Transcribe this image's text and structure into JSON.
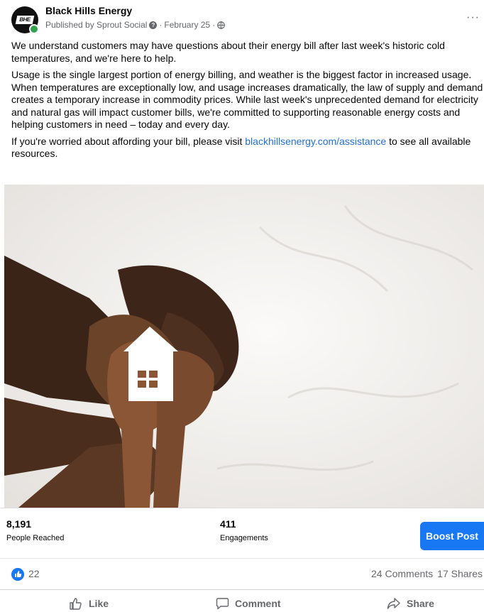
{
  "post": {
    "page_name": "Black Hills Energy",
    "published_by": "Published by Sprout Social",
    "date": "February 25",
    "separator": "·",
    "avatar_text": "BHE",
    "more": "···"
  },
  "body": {
    "p1": "We understand customers may have questions about their energy bill after last week's historic cold temperatures, and we're here to help.",
    "p2": "Usage is the single largest portion of energy billing, and weather is the biggest factor in increased usage. When temperatures are exceptionally low, and usage increases dramatically, the law of supply and demand creates a temporary increase in commodity prices. While last week's unprecedented demand for electricity and natural gas will impact customer bills, we're committed to supporting reasonable energy costs and helping customers in need – today and every day.",
    "p3_before": "If you're worried about affording your bill, please visit ",
    "p3_link": "blackhillsenergy.com/assistance",
    "p3_after": " to see all available resources."
  },
  "stats": {
    "reached_value": "8,191",
    "reached_label": "People Reached",
    "engagements_value": "411",
    "engagements_label": "Engagements",
    "boost_label": "Boost Post"
  },
  "reactions": {
    "count": "22",
    "comments": "24 Comments",
    "shares": "17 Shares"
  },
  "actions": {
    "like": "Like",
    "comment": "Comment",
    "share": "Share"
  },
  "colors": {
    "accent": "#1877f2",
    "link": "#216fdb",
    "online": "#31a24c"
  }
}
